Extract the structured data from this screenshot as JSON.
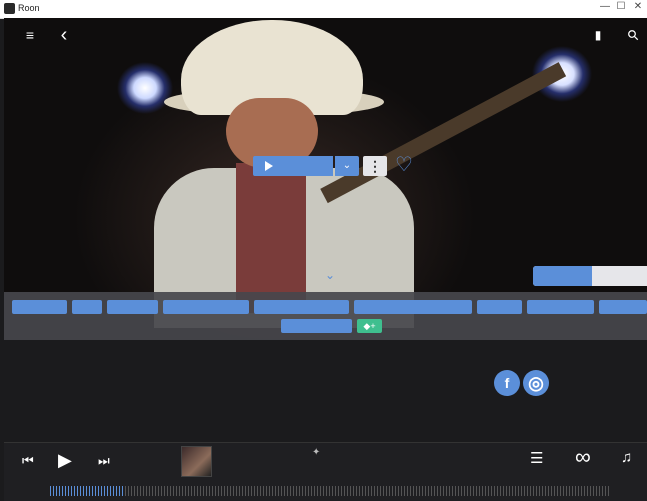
{
  "window": {
    "title": "Roon",
    "minimize_glyph": "—",
    "maximize_glyph": "☐",
    "close_glyph": "✕"
  },
  "header": {
    "menu_glyph": "≡",
    "back_glyph": "‹",
    "bookmark_glyph": "▮",
    "search_glyph": "⚲"
  },
  "actions": {
    "dropdown_glyph": "⌄",
    "more_glyph": "⋮",
    "heart_glyph": "♡",
    "expand_glyph": "⌄"
  },
  "progress": {
    "fraction": 0.52
  },
  "tags": {
    "add_glyph": "◆+"
  },
  "social": {
    "facebook_glyph": "f",
    "web_glyph": "◎"
  },
  "player": {
    "prev_glyph": "⏮",
    "play_glyph": "▶",
    "next_glyph": "⏭",
    "queue_glyph": "☰",
    "link_glyph": "∞",
    "volume_glyph": "♫",
    "shuffle_glyph": "✦",
    "played_fraction": 0.13
  },
  "colors": {
    "accent": "#5b8fd9",
    "tag_add": "#3fbf8f",
    "background": "#1b1b1d"
  },
  "icons": [
    "menu-icon",
    "back-icon",
    "bookmark-icon",
    "search-icon",
    "play-icon",
    "chevron-down-icon",
    "more-icon",
    "heart-icon",
    "tag-add-icon",
    "facebook-icon",
    "globe-icon",
    "prev-icon",
    "next-icon",
    "queue-icon",
    "link-icon",
    "volume-icon"
  ]
}
